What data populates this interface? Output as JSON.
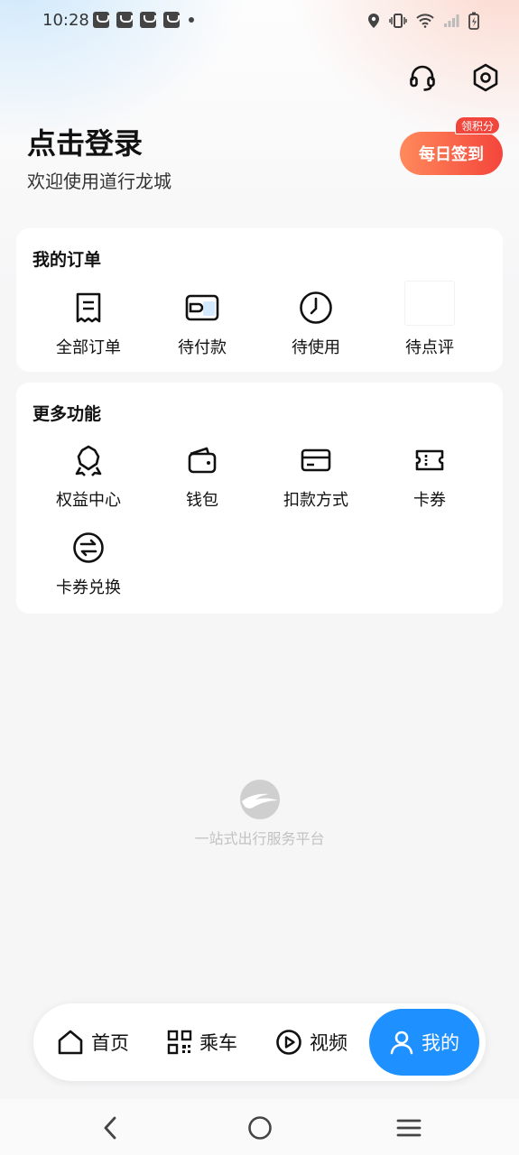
{
  "status_bar": {
    "time": "10:28"
  },
  "header": {
    "login_title": "点击登录",
    "login_subtitle": "欢迎使用道行龙城",
    "checkin_label": "每日签到",
    "points_badge": "领积分"
  },
  "orders": {
    "title": "我的订单",
    "items": [
      {
        "label": "全部订单",
        "icon": "receipt-icon"
      },
      {
        "label": "待付款",
        "icon": "wallet-card-icon"
      },
      {
        "label": "待使用",
        "icon": "clock-icon"
      },
      {
        "label": "待点评",
        "icon": "blank-icon"
      }
    ]
  },
  "more": {
    "title": "更多功能",
    "items": [
      {
        "label": "权益中心",
        "icon": "badge-icon"
      },
      {
        "label": "钱包",
        "icon": "wallet-icon"
      },
      {
        "label": "扣款方式",
        "icon": "card-icon"
      },
      {
        "label": "卡券",
        "icon": "ticket-icon"
      },
      {
        "label": "卡券兑换",
        "icon": "exchange-icon"
      }
    ]
  },
  "brand": {
    "slogan": "一站式出行服务平台"
  },
  "tabbar": {
    "home": "首页",
    "ride": "乘车",
    "video": "视频",
    "mine": "我的"
  },
  "colors": {
    "accent": "#1e90ff",
    "checkin": "#f4453b"
  }
}
